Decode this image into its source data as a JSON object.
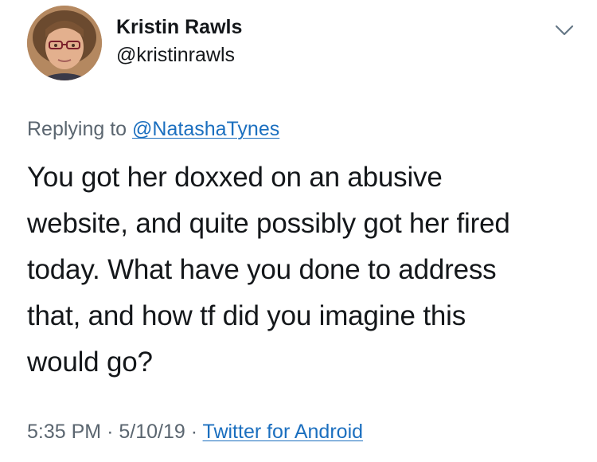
{
  "author": {
    "display_name": "Kristin Rawls",
    "handle": "@kristinrawls"
  },
  "icons": {
    "avatar": "profile-photo",
    "menu": "chevron-down-icon"
  },
  "reply": {
    "prefix": "Replying to",
    "mention": "@NatashaTynes"
  },
  "tweet": {
    "lines": [
      "You got her doxxed on an abusive",
      "website, and quite possibly got her fired",
      "today. What have you done to address",
      "that, and how tf did you imagine this",
      "would go?"
    ]
  },
  "meta": {
    "time": "5:35 PM",
    "separator": "·",
    "date": "5/10/19",
    "source": "Twitter for Android"
  },
  "colors": {
    "text": "#14171a",
    "secondary": "#5b6670",
    "link": "#1b6fbf",
    "background": "#ffffff"
  }
}
